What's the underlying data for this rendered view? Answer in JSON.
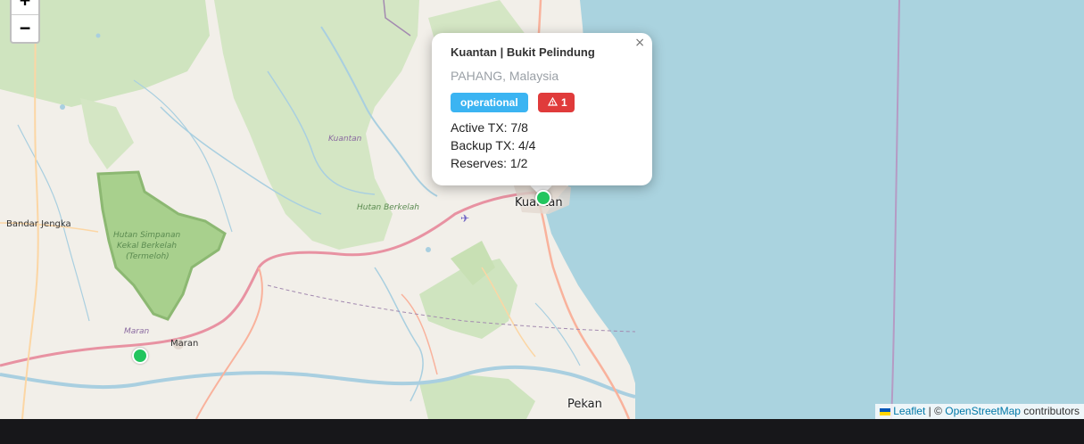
{
  "map": {
    "labels": {
      "kuantan_district": "Kuantan",
      "hutan_berkelah": "Hutan Berkelah",
      "bandar_jengka": "Bandar Jengka",
      "hutan_simpanan_1": "Hutan Simpanan",
      "hutan_simpanan_2": "Kekal Berkelah",
      "hutan_simpanan_3": "(Termeloh)",
      "maran_district": "Maran",
      "maran_town": "Maran",
      "kuantan_city": "Kuantan",
      "pekan": "Pekan"
    },
    "zoom": {
      "in_label": "+",
      "out_label": "−"
    }
  },
  "popup": {
    "close_label": "×",
    "title": "Kuantan | Bukit Pelindung",
    "region": "PAHANG, Malaysia",
    "status_badge": "operational",
    "alert_count": "1",
    "active_tx": "Active TX: 7/8",
    "backup_tx": "Backup TX: 4/4",
    "reserves": "Reserves: 1/2"
  },
  "markers": [
    {
      "name": "Kuantan | Bukit Pelindung",
      "color": "#22c55e"
    },
    {
      "name": "Maran",
      "color": "#22c55e"
    }
  ],
  "attribution": {
    "leaflet": "Leaflet",
    "separator": " | © ",
    "osm": "OpenStreetMap",
    "suffix": " contributors"
  },
  "colors": {
    "sea": "#aad3df",
    "forest": "#c8e0b4",
    "status_operational": "#3bb4f2",
    "status_alert": "#e03b3b",
    "marker": "#22c55e"
  }
}
